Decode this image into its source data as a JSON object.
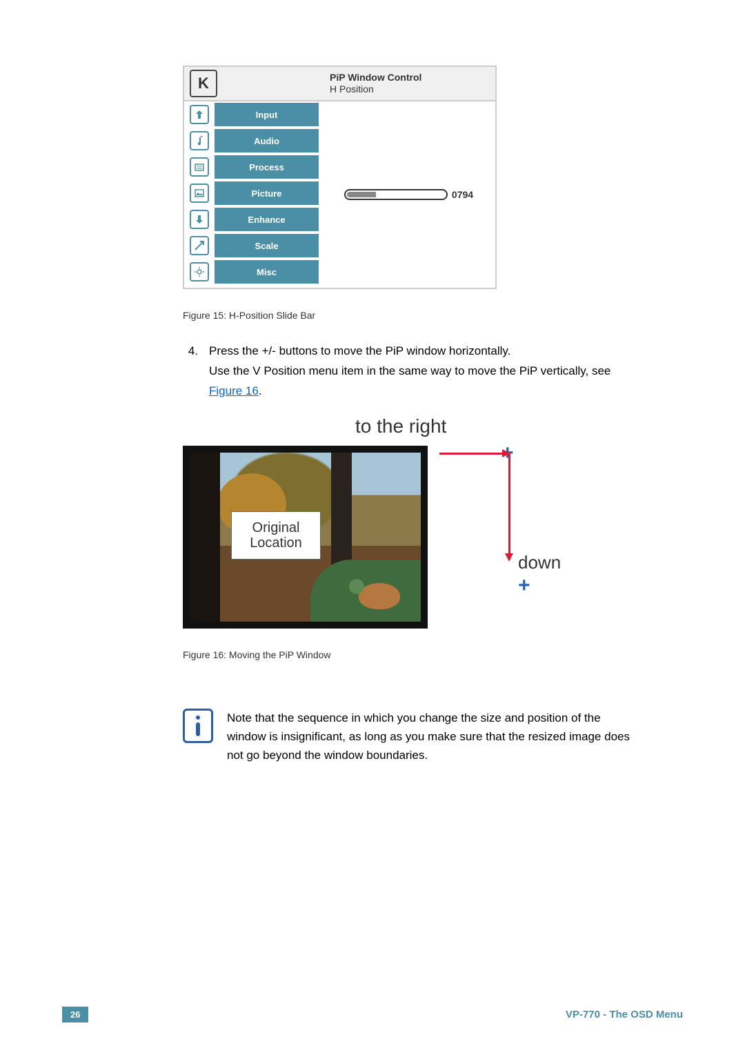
{
  "osd": {
    "title_line1": "PiP Window Control",
    "title_line2": "H Position",
    "items": [
      {
        "label": "Input"
      },
      {
        "label": "Audio"
      },
      {
        "label": "Process"
      },
      {
        "label": "Picture"
      },
      {
        "label": "Enhance"
      },
      {
        "label": "Scale"
      },
      {
        "label": "Misc"
      }
    ],
    "slider_value": "0794"
  },
  "caption_fig15": "Figure 15: H-Position Slide Bar",
  "step": {
    "number": "4.",
    "line1": "Press the +/- buttons to move the PiP window horizontally.",
    "line2a": "Use the V Position menu item in the same way to move the PiP vertically, see ",
    "fig_link_text": "Figure 16",
    "line2b": "."
  },
  "fig16": {
    "to_right": "to the right",
    "plus_right": "+",
    "down": "down",
    "plus_down": "+",
    "original": "Original Location"
  },
  "caption_fig16": "Figure 16: Moving the PiP Window",
  "note_text": "Note that the sequence in which you change the size and position of the window is insignificant, as long as you make sure that the resized image does not go beyond the window boundaries.",
  "footer": {
    "page": "26",
    "doc": "VP-770 - The OSD Menu"
  }
}
